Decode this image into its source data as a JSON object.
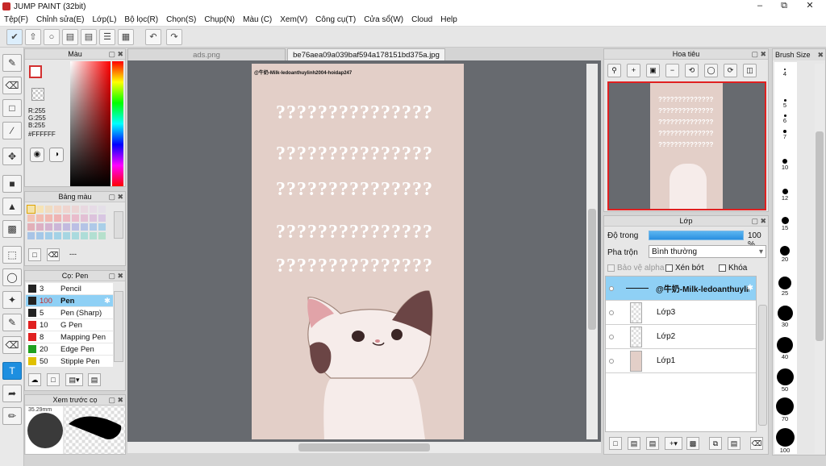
{
  "app": {
    "title": "JUMP PAINT (32bit)"
  },
  "menu": [
    "Tệp(F)",
    "Chỉnh sửa(E)",
    "Lớp(L)",
    "Bộ lọc(R)",
    "Chọn(S)",
    "Chụp(N)",
    "Màu (C)",
    "Xem(V)",
    "Công cụ(T)",
    "Cửa sổ(W)",
    "Cloud",
    "Help"
  ],
  "color_panel": {
    "title": "Màu",
    "r": "R:255",
    "g": "G:255",
    "b": "B:255",
    "hex": "#FFFFFF"
  },
  "palette_panel": {
    "title": "Bảng màu",
    "extra": "---"
  },
  "brush_panel": {
    "title": "Cọ: Pen",
    "brushes": [
      {
        "size": "3",
        "name": "Pencil",
        "color": "#222222"
      },
      {
        "size": "100",
        "name": "Pen",
        "color": "#222222",
        "selected": true
      },
      {
        "size": "5",
        "name": "Pen (Sharp)",
        "color": "#222222"
      },
      {
        "size": "10",
        "name": "G Pen",
        "color": "#e02020"
      },
      {
        "size": "8",
        "name": "Mapping Pen",
        "color": "#e02020"
      },
      {
        "size": "20",
        "name": "Edge Pen",
        "color": "#20a020"
      },
      {
        "size": "50",
        "name": "Stipple Pen",
        "color": "#e0c000"
      }
    ]
  },
  "preview_panel": {
    "title": "Xem trước cọ",
    "size": "35.29mm"
  },
  "tabs": [
    "ads.png",
    "be76aea09a039baf594a178151bd375a.jpg"
  ],
  "document": {
    "header": "@牛奶-Milk-ledoanthuylinh2004-hoidap247",
    "question_rows": [
      "???????????????",
      "???????????????",
      "???????????????",
      "???????????????",
      "???????????????"
    ]
  },
  "navigator": {
    "title": "Hoa tiêu"
  },
  "layers": {
    "title": "Lớp",
    "opacity_label": "Độ trong",
    "opacity_value": "100 %",
    "opacity": 1.0,
    "blend_label": "Pha trộn",
    "blend_value": "Bình thường",
    "protect_alpha": "Bảo vệ alpha",
    "clip": "Xén bớt",
    "lock": "Khóa",
    "items": [
      {
        "name": "@牛奶-Milk-ledoanthuylinh",
        "selected": true
      },
      {
        "name": "Lớp3"
      },
      {
        "name": "Lớp2"
      },
      {
        "name": "Lớp1"
      }
    ]
  },
  "brushsize": {
    "title": "Brush Size",
    "sizes": [
      "4",
      "5",
      "6",
      "7",
      "10",
      "12",
      "15",
      "20",
      "25",
      "30",
      "40",
      "50",
      "70",
      "100"
    ]
  },
  "colors": {
    "accent": "#1e8fe0",
    "canvas_bg": "#676a6f",
    "doc_bg": "#e3cfc8",
    "layer_selected": "#8fd0f5",
    "nav_frame": "#e02020"
  }
}
